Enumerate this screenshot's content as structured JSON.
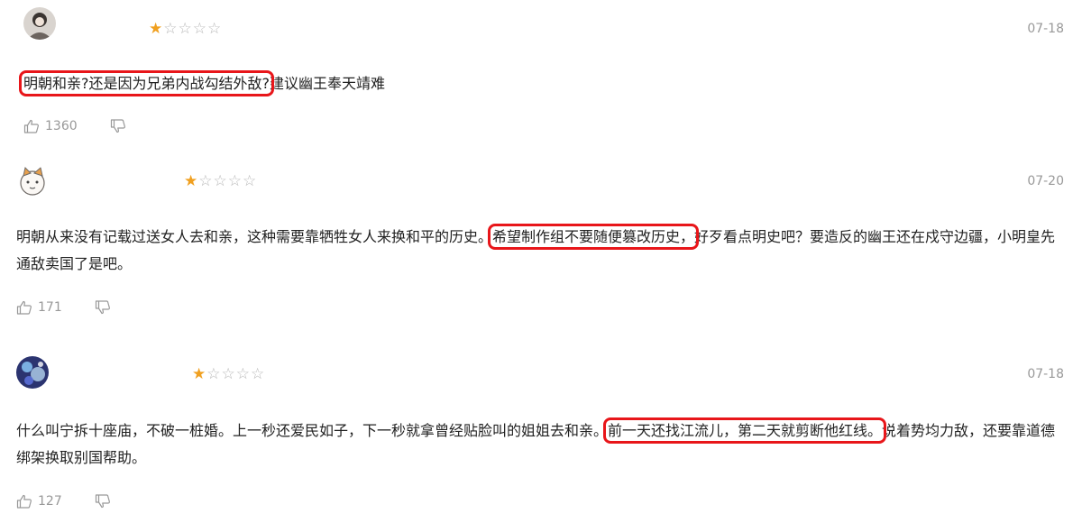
{
  "comments": [
    {
      "rating": 1,
      "date": "07-18",
      "text": [
        {
          "t": "明朝和亲?还是因为兄弟内战勾结外敌?",
          "hl": true
        },
        {
          "t": "建议幽王奉天靖难",
          "hl": false
        }
      ],
      "likes": "1360"
    },
    {
      "rating": 1,
      "date": "07-20",
      "text": [
        {
          "t": "明朝从来没有记载过送女人去和亲，这种需要靠牺牲女人来换和平的历史。",
          "hl": false
        },
        {
          "t": "希望制作组不要随便篡改历史，",
          "hl": true
        },
        {
          "t": "好歹看点明史吧？要造反的幽王还在戍守边疆，小明皇先通敌卖国了是吧。",
          "hl": false
        }
      ],
      "likes": "171"
    },
    {
      "rating": 1,
      "date": "07-18",
      "text": [
        {
          "t": "什么叫宁拆十座庙，不破一桩婚。上一秒还爱民如子，下一秒就拿曾经贴脸叫的姐姐去和亲。",
          "hl": false
        },
        {
          "t": "前一天还找江流儿，第二天就剪断他红线。",
          "hl": true
        },
        {
          "t": "说着势均力敌，还要靠道德绑架换取别国帮助。",
          "hl": false
        }
      ],
      "likes": "127"
    }
  ],
  "colors": {
    "star_filled": "#f0a020",
    "star_empty": "#b8b8b8",
    "highlight": "#e8161a",
    "meta": "#999999"
  },
  "icons": {
    "like": "thumbs-up-icon",
    "dislike": "thumbs-down-icon"
  }
}
